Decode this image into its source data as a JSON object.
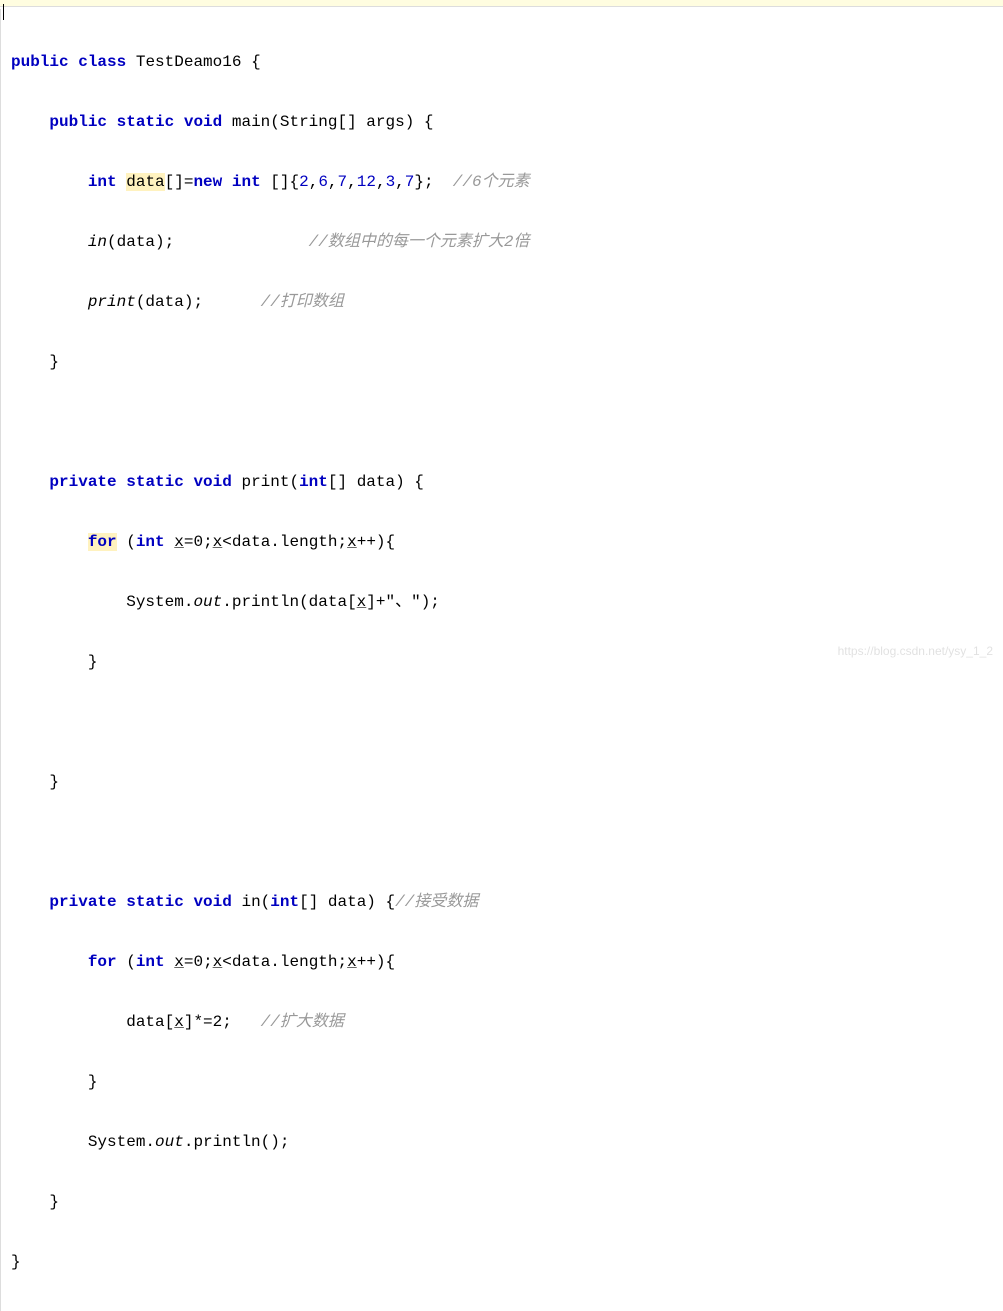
{
  "cursor_line": "",
  "lines": {
    "l1a": "public",
    "l1b": "class",
    "l1c": "TestDeamo16 {",
    "l2a": "public",
    "l2b": "static",
    "l2c": "void",
    "l2d": "main(String[] args) {",
    "l3a": "int",
    "l3b": "data",
    "l3c": "[]=",
    "l3d": "new",
    "l3e": "int",
    "l3f": " []{",
    "l3g": "2",
    "l3h": ",",
    "l3i": "6",
    "l3j": ",",
    "l3k": "7",
    "l3l": ",",
    "l3m": "12",
    "l3n": ",",
    "l3o": "3",
    "l3p": ",",
    "l3q": "7",
    "l3r": "};  ",
    "l3s": "//6个元素",
    "l4a": "in",
    "l4b": "(data);",
    "l4c": "//数组中的每一个元素扩大2倍",
    "l5a": "print",
    "l5b": "(data);",
    "l5c": "//打印数组",
    "l6": "}",
    "l7a": "private",
    "l7b": "static",
    "l7c": "void",
    "l7d": "print(",
    "l7e": "int",
    "l7f": "[] data) {",
    "l8a": "for",
    "l8b": " (",
    "l8c": "int",
    "l8d": " ",
    "l8e": "x",
    "l8f": "=0;",
    "l8g": "x",
    "l8h": "<data.",
    "l8i": "length",
    "l8j": ";",
    "l8k": "x",
    "l8l": "++){",
    "l9a": "System.",
    "l9b": "out",
    "l9c": ".println(data[",
    "l9d": "x",
    "l9e": "]+\"、\");",
    "l10": "}",
    "l11": "}",
    "l12a": "private",
    "l12b": "static",
    "l12c": "void",
    "l12d": "in(",
    "l12e": "int",
    "l12f": "[] data) {",
    "l12g": "//接受数据",
    "l13a": "for",
    "l13b": " (",
    "l13c": "int",
    "l13d": " ",
    "l13e": "x",
    "l13f": "=0;",
    "l13g": "x",
    "l13h": "<data.",
    "l13i": "length",
    "l13j": ";",
    "l13k": "x",
    "l13l": "++){",
    "l14a": "data[",
    "l14b": "x",
    "l14c": "]*=2;   ",
    "l14d": "//扩大数据",
    "l15": "}",
    "l16a": "System.",
    "l16b": "out",
    "l16c": ".println();",
    "l17": "}",
    "l18": "}"
  },
  "watermark": "https://blog.csdn.net/ysy_1_2"
}
